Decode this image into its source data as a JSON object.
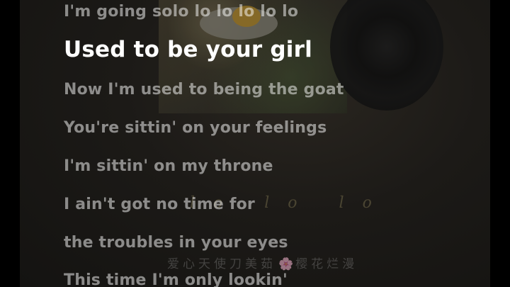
{
  "lyrics": {
    "lines": [
      {
        "text": "I'm going solo lo lo lo lo lo",
        "current": false
      },
      {
        "text": "Used to be your girl",
        "current": true
      },
      {
        "text": "Now I'm used to being the goat",
        "current": false
      },
      {
        "text": "You're sittin' on your feelings",
        "current": false
      },
      {
        "text": "I'm sittin' on my throne",
        "current": false
      },
      {
        "text": "I ain't got no time for",
        "current": false
      },
      {
        "text": "the troubles in your eyes",
        "current": false
      },
      {
        "text": "This time I'm only lookin'",
        "current": false
      }
    ]
  },
  "watermark": {
    "script_text": "lo lo lo",
    "left_text": "爱心天使刀美茹",
    "flower_icon": "cherry-blossom-icon",
    "flower_glyph": "🌸",
    "right_text": "樱花烂漫"
  },
  "colors": {
    "current_line": "#ffffff",
    "other_lines": "rgba(255,255,255,0.5)",
    "background": "#000000"
  }
}
